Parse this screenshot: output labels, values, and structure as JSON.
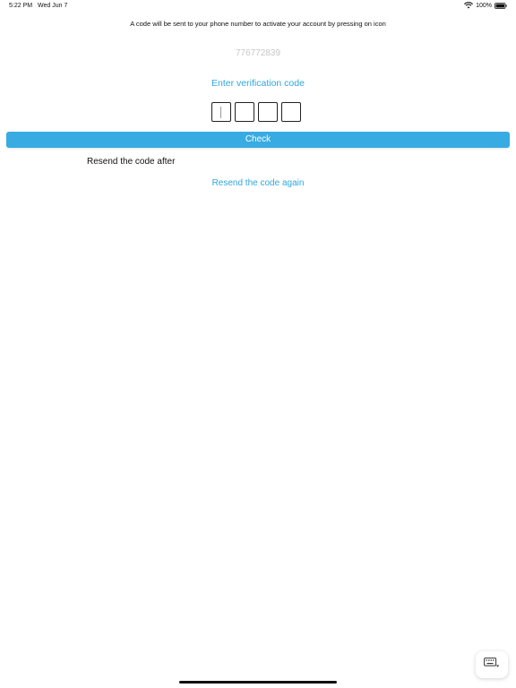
{
  "status_bar": {
    "time": "5:22 PM",
    "date": "Wed Jun 7",
    "battery": "100%",
    "icons": [
      "wifi-icon",
      "battery-icon"
    ]
  },
  "verification": {
    "info": "A code will be sent to your phone number to activate your account by pressing on icon",
    "phone_number": "776772839",
    "title": "Enter verification code",
    "code_digits": [
      "",
      "",
      "",
      ""
    ],
    "check_label": "Check",
    "resend_after": "Resend the code after",
    "resend_again": "Resend the code again"
  },
  "keyboard": {
    "icon": "keyboard-dismiss-icon"
  },
  "colors": {
    "accent": "#38abe2",
    "link": "#2ea8dc",
    "placeholder": "#c8c8c8"
  }
}
